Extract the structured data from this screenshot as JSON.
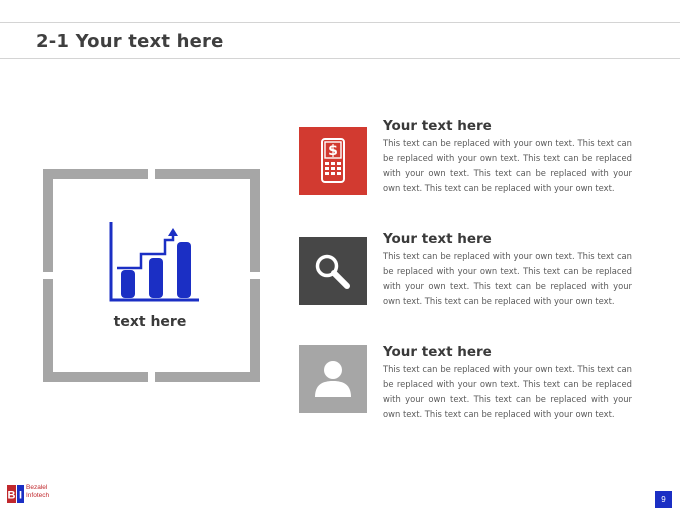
{
  "slide": {
    "title": "2-1 Your text here",
    "page_number": "9"
  },
  "panel": {
    "caption": "text here",
    "icon": "bar-chart-icon"
  },
  "items": [
    {
      "icon": "mobile-phone-dollar-icon",
      "icon_color": "#d23a30",
      "heading": "Your text here",
      "body": "This text can be replaced with your own text. This text can be replaced with your own text. This text can be replaced with your own text. This text can be replaced with your own text. This text can be replaced with your own text."
    },
    {
      "icon": "magnifier-icon",
      "icon_color": "#474747",
      "heading": "Your text here",
      "body": "This text can be replaced with your own text. This text can be replaced with your own text. This text can be replaced with your own text. This text can be replaced with your own text. This text can be replaced with your own text."
    },
    {
      "icon": "user-icon",
      "icon_color": "#a6a6a6",
      "heading": "Your text here",
      "body": "This text can be replaced with your own text. This text can be replaced with your own text. This text can be replaced with your own text. This text can be replaced with your own text. This text can be replaced with your own text."
    }
  ],
  "logo": {
    "line1": "Bezalel",
    "line2": "Infotech"
  },
  "colors": {
    "accent_blue": "#1b2fc4",
    "frame_gray": "#a6a6a6",
    "logo_red": "#c0282d"
  }
}
